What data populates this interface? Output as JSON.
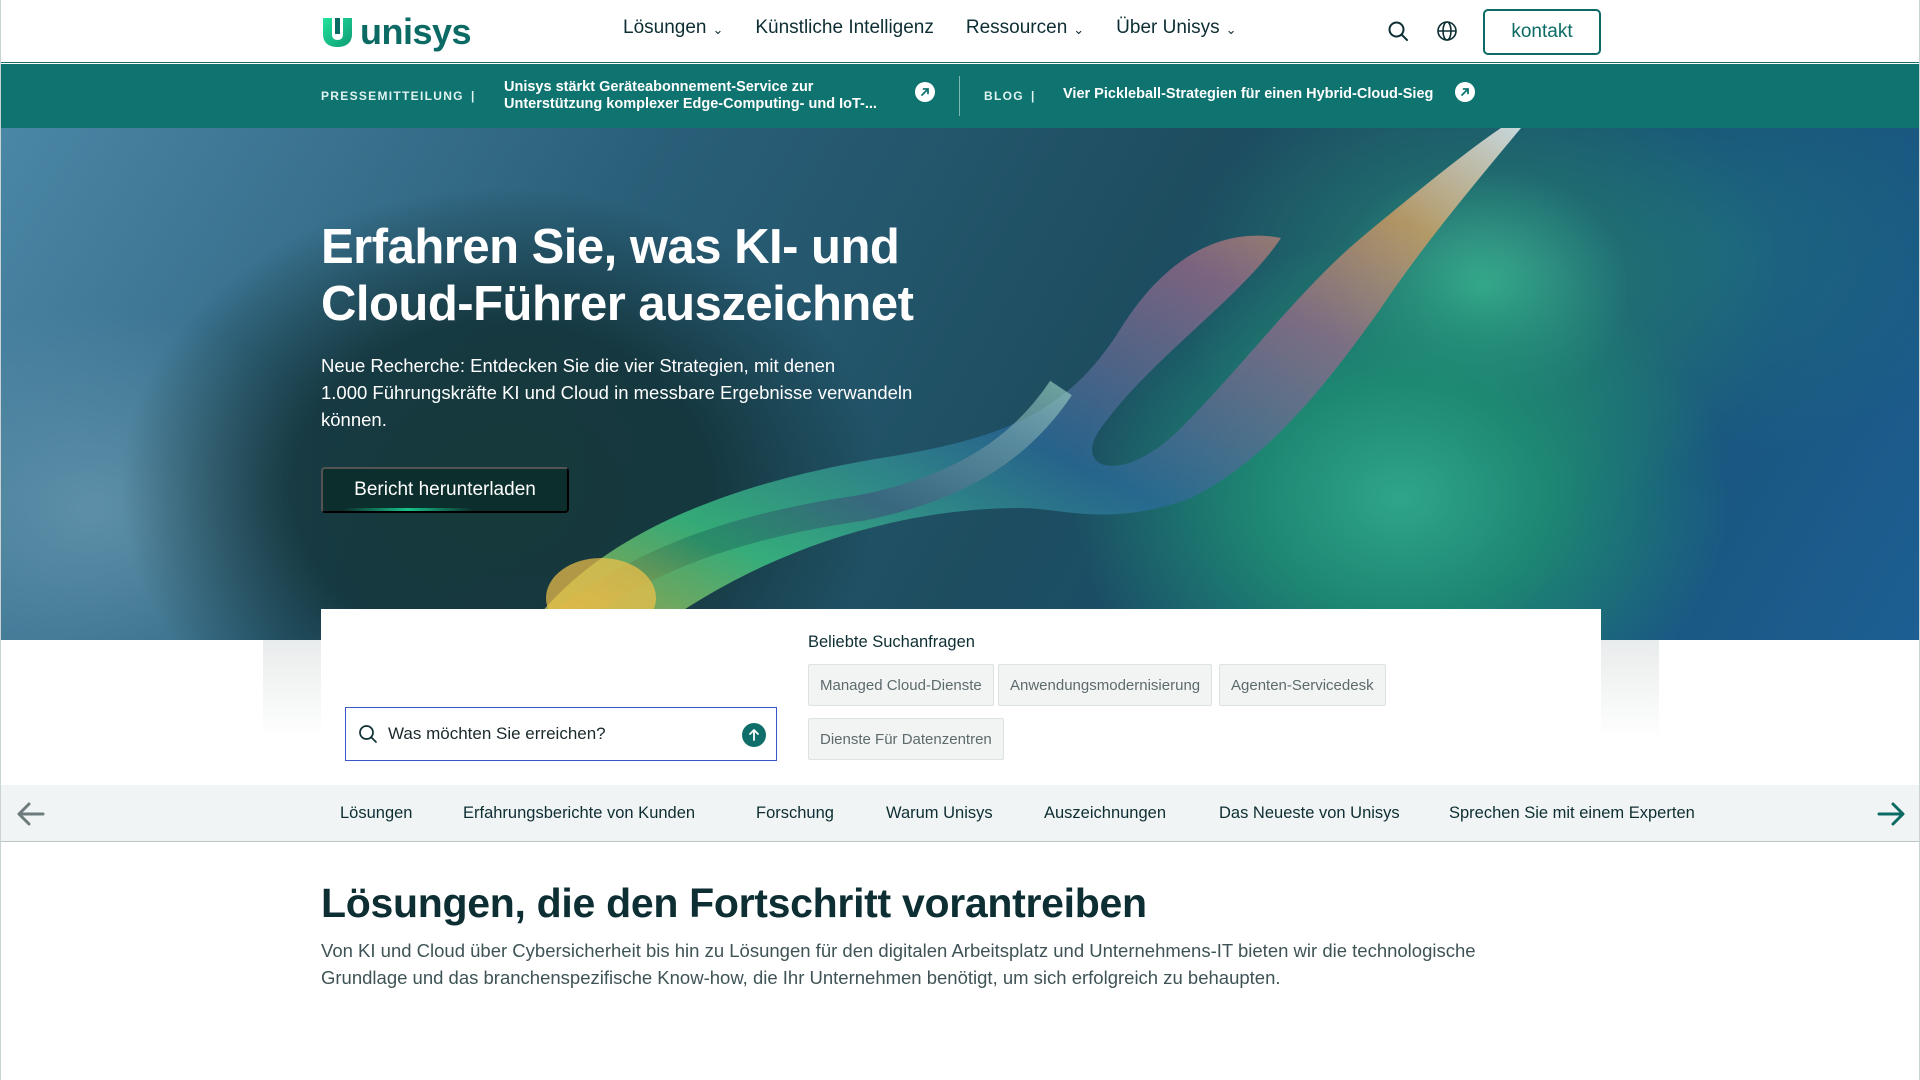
{
  "header": {
    "logo_text": "unisys",
    "nav": [
      {
        "label": "Lösungen",
        "has_dropdown": true
      },
      {
        "label": "Künstliche Intelligenz",
        "has_dropdown": false
      },
      {
        "label": "Ressourcen",
        "has_dropdown": true
      },
      {
        "label": "Über Unisys",
        "has_dropdown": true
      }
    ],
    "icons": [
      "search-icon",
      "globe-icon"
    ],
    "contact_label": "kontakt"
  },
  "newsbar": {
    "item1": {
      "tag": "PRESSEMITTEILUNG",
      "separator": "|",
      "line1": "Unisys stärkt Geräteabonnement-Service zur",
      "line2": "Unterstützung komplexer Edge-Computing- und IoT-..."
    },
    "item2": {
      "tag": "BLOG",
      "separator": "|",
      "text": "Vier Pickleball-Strategien für einen Hybrid-Cloud-Sieg"
    }
  },
  "hero": {
    "title_line1": "Erfahren Sie, was KI- und",
    "title_line2": "Cloud-Führer auszeichnet",
    "subtitle_line1": "Neue Recherche: Entdecken Sie die vier Strategien, mit denen",
    "subtitle_line2": "1.000 Führungskräfte KI und Cloud in messbare Ergebnisse verwandeln",
    "subtitle_line3": "können.",
    "cta_label": "Bericht herunterladen"
  },
  "search": {
    "placeholder": "Was möchten Sie erreichen?",
    "popular_label": "Beliebte Suchanfragen",
    "chips": [
      "Managed Cloud-Dienste",
      "Anwendungsmodernisierung",
      "Agenten-Servicedesk",
      "Dienste Für Datenzentren"
    ]
  },
  "anchor_nav": {
    "items": [
      "Lösungen",
      "Erfahrungsberichte von Kunden",
      "Forschung",
      "Warum Unisys",
      "Auszeichnungen",
      "Das Neueste von Unisys",
      "Sprechen Sie mit einem Experten"
    ]
  },
  "solutions": {
    "title": "Lösungen, die den Fortschritt vorantreiben",
    "text_line1": "Von KI und Cloud über Cybersicherheit bis hin zu Lösungen für den digitalen Arbeitsplatz und Unternehmens-IT bieten wir die technologische",
    "text_line2": "Grundlage und das branchenspezifische Know-how, die Ihr Unternehmen benötigt, um sich erfolgreich zu behaupten."
  },
  "colors": {
    "brand_teal": "#0b6b64",
    "newsbar_bg": "#0f7470",
    "dark_button": "#0c2e2d",
    "logo_green": "#1fd28f"
  }
}
